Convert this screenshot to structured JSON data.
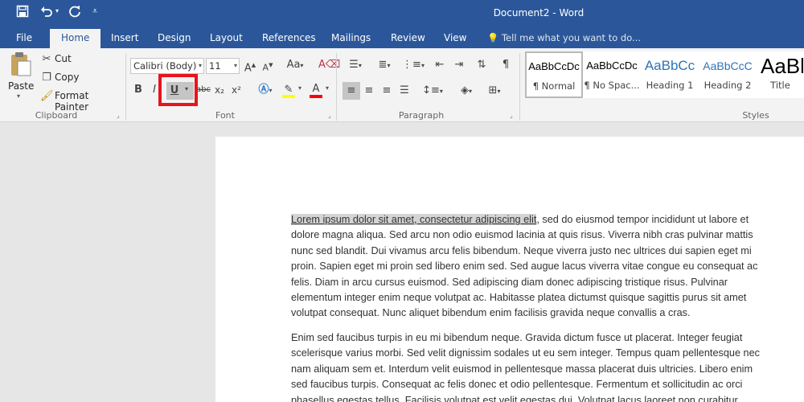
{
  "window": {
    "title": "Document2 - Word"
  },
  "qat": {
    "save_icon": "save-icon",
    "undo_icon": "undo-icon",
    "redo_icon": "redo-icon"
  },
  "tabs": [
    "File",
    "Home",
    "Insert",
    "Design",
    "Layout",
    "References",
    "Mailings",
    "Review",
    "View"
  ],
  "tell_me": "Tell me what you want to do...",
  "clipboard": {
    "paste": "Paste",
    "cut": "Cut",
    "copy": "Copy",
    "format_painter": "Format Painter",
    "group": "Clipboard"
  },
  "font": {
    "name": "Calibri (Body)",
    "size": "11",
    "group": "Font",
    "bold": "B",
    "italic": "I",
    "underline": "U",
    "strike": "abc",
    "sub": "x₂",
    "sup": "x²"
  },
  "paragraph": {
    "group": "Paragraph"
  },
  "styles": {
    "group": "Styles",
    "items": [
      {
        "preview": "AaBbCcDc",
        "name": "¶ Normal"
      },
      {
        "preview": "AaBbCcDc",
        "name": "¶ No Spac..."
      },
      {
        "preview": "AaBbCc",
        "name": "Heading 1"
      },
      {
        "preview": "AaBbCcC",
        "name": "Heading 2"
      },
      {
        "preview": "AaBb",
        "name": "Title"
      }
    ]
  },
  "colors": {
    "ribbon_blue": "#2b579a",
    "highlight": "#ffff00",
    "font_color": "#ff0000",
    "callout": "#e8141c"
  },
  "document": {
    "selected_text": "Lorem ipsum dolor sit amet, consectetur adipiscing elit",
    "para1_rest": ", sed do eiusmod tempor incididunt ut labore et\ndolore magna aliqua. Sed arcu non odio euismod lacinia at quis risus. Viverra nibh cras pulvinar mattis\nnunc sed blandit. Dui vivamus arcu felis bibendum. Neque viverra justo nec ultrices dui sapien eget mi\nproin. Sapien eget mi proin sed libero enim sed. Sed augue lacus viverra vitae congue eu consequat ac\nfelis. Diam in arcu cursus euismod. Sed adipiscing diam donec adipiscing tristique risus. Pulvinar\nelementum integer enim neque volutpat ac. Habitasse platea dictumst quisque sagittis purus sit amet\nvolutpat consequat. Nunc aliquet bibendum enim facilisis gravida neque convallis a cras.",
    "para2": "Enim sed faucibus turpis in eu mi bibendum neque. Gravida dictum fusce ut placerat. Integer feugiat\nscelerisque varius morbi. Sed velit dignissim sodales ut eu sem integer. Tempus quam pellentesque nec\nnam aliquam sem et. Interdum velit euismod in pellentesque massa placerat duis ultricies. Libero enim\nsed faucibus turpis. Consequat ac felis donec et odio pellentesque. Fermentum et sollicitudin ac orci\nphasellus egestas tellus. Facilisis volutpat est velit egestas dui. Volutpat lacus laoreet non curabitur"
  }
}
